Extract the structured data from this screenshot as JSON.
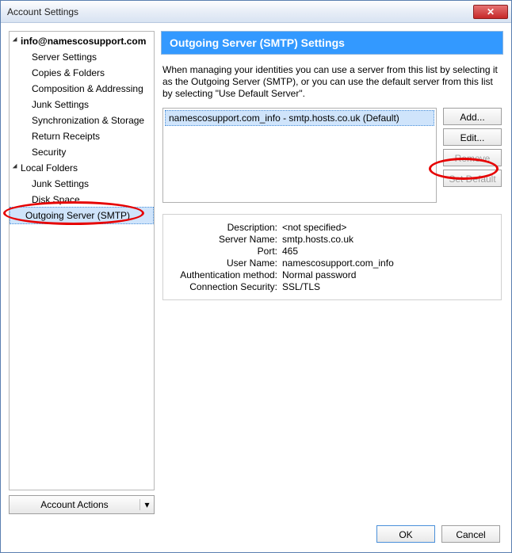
{
  "window": {
    "title": "Account Settings"
  },
  "tree": {
    "account": "info@namescosupport.com",
    "items": [
      "Server Settings",
      "Copies & Folders",
      "Composition & Addressing",
      "Junk Settings",
      "Synchronization & Storage",
      "Return Receipts",
      "Security"
    ],
    "local": "Local Folders",
    "local_items": [
      "Junk Settings",
      "Disk Space"
    ],
    "smtp": "Outgoing Server (SMTP)"
  },
  "account_actions": "Account Actions",
  "panel": {
    "title": "Outgoing Server (SMTP) Settings",
    "instructions": "When managing your identities you can use a server from this list by selecting it as the Outgoing Server (SMTP), or you can use the default server from this list by selecting \"Use Default Server\".",
    "list_item": "namescosupport.com_info - smtp.hosts.co.uk (Default)",
    "buttons": {
      "add": "Add...",
      "edit": "Edit...",
      "remove": "Remove",
      "setdefault": "Set Default"
    },
    "details": {
      "Description": "<not specified>",
      "Server Name": "smtp.hosts.co.uk",
      "Port": "465",
      "User Name": "namescosupport.com_info",
      "Authentication method": "Normal password",
      "Connection Security": "SSL/TLS"
    }
  },
  "footer": {
    "ok": "OK",
    "cancel": "Cancel"
  }
}
